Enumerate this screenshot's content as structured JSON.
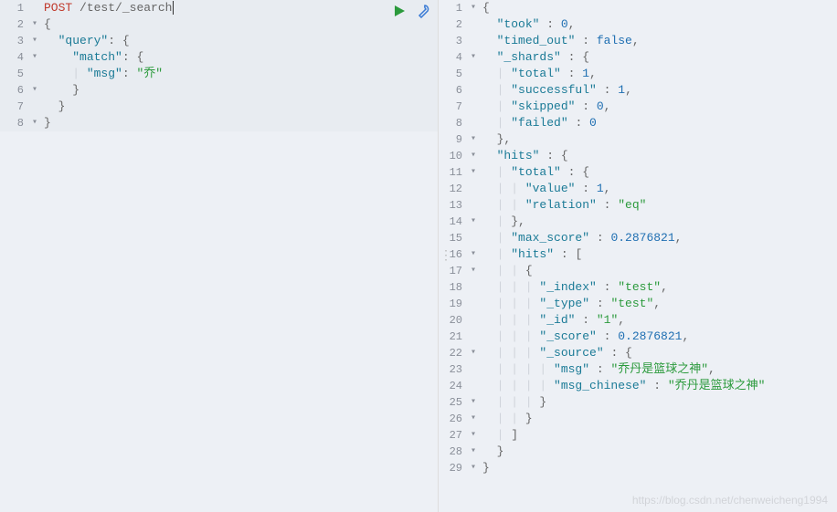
{
  "left": {
    "toolbar": {
      "run": "run-icon",
      "config": "wrench-icon"
    },
    "lines": [
      {
        "n": "1",
        "fold": "",
        "tokens": [
          [
            "method",
            "POST"
          ],
          [
            "plain",
            " "
          ],
          [
            "path",
            "/test/_search"
          ],
          [
            "cursor",
            ""
          ]
        ]
      },
      {
        "n": "2",
        "fold": "▾",
        "tokens": [
          [
            "brace",
            "{"
          ]
        ]
      },
      {
        "n": "3",
        "fold": "▾",
        "tokens": [
          [
            "plain",
            "  "
          ],
          [
            "key",
            "\"query\""
          ],
          [
            "colon",
            ": "
          ],
          [
            "brace",
            "{"
          ]
        ]
      },
      {
        "n": "4",
        "fold": "▾",
        "tokens": [
          [
            "plain",
            "    "
          ],
          [
            "key",
            "\"match\""
          ],
          [
            "colon",
            ": "
          ],
          [
            "brace",
            "{"
          ]
        ]
      },
      {
        "n": "5",
        "fold": "",
        "tokens": [
          [
            "indent",
            "    | "
          ],
          [
            "key",
            "\"msg\""
          ],
          [
            "colon",
            ": "
          ],
          [
            "string",
            "\"乔\""
          ]
        ]
      },
      {
        "n": "6",
        "fold": "▾",
        "tokens": [
          [
            "indent",
            "    "
          ],
          [
            "brace",
            "}"
          ]
        ]
      },
      {
        "n": "7",
        "fold": "",
        "tokens": [
          [
            "plain",
            "  "
          ],
          [
            "brace",
            "}"
          ]
        ]
      },
      {
        "n": "8",
        "fold": "▾",
        "tokens": [
          [
            "brace",
            "}"
          ]
        ]
      }
    ]
  },
  "right": {
    "lines": [
      {
        "n": "1",
        "fold": "▾",
        "tokens": [
          [
            "brace",
            "{"
          ]
        ]
      },
      {
        "n": "2",
        "fold": "",
        "tokens": [
          [
            "plain",
            "  "
          ],
          [
            "key",
            "\"took\""
          ],
          [
            "colon",
            " : "
          ],
          [
            "number",
            "0"
          ],
          [
            "punct",
            ","
          ]
        ]
      },
      {
        "n": "3",
        "fold": "",
        "tokens": [
          [
            "plain",
            "  "
          ],
          [
            "key",
            "\"timed_out\""
          ],
          [
            "colon",
            " : "
          ],
          [
            "bool",
            "false"
          ],
          [
            "punct",
            ","
          ]
        ]
      },
      {
        "n": "4",
        "fold": "▾",
        "tokens": [
          [
            "plain",
            "  "
          ],
          [
            "key",
            "\"_shards\""
          ],
          [
            "colon",
            " : "
          ],
          [
            "brace",
            "{"
          ]
        ]
      },
      {
        "n": "5",
        "fold": "",
        "tokens": [
          [
            "indent",
            "  | "
          ],
          [
            "key",
            "\"total\""
          ],
          [
            "colon",
            " : "
          ],
          [
            "number",
            "1"
          ],
          [
            "punct",
            ","
          ]
        ]
      },
      {
        "n": "6",
        "fold": "",
        "tokens": [
          [
            "indent",
            "  | "
          ],
          [
            "key",
            "\"successful\""
          ],
          [
            "colon",
            " : "
          ],
          [
            "number",
            "1"
          ],
          [
            "punct",
            ","
          ]
        ]
      },
      {
        "n": "7",
        "fold": "",
        "tokens": [
          [
            "indent",
            "  | "
          ],
          [
            "key",
            "\"skipped\""
          ],
          [
            "colon",
            " : "
          ],
          [
            "number",
            "0"
          ],
          [
            "punct",
            ","
          ]
        ]
      },
      {
        "n": "8",
        "fold": "",
        "tokens": [
          [
            "indent",
            "  | "
          ],
          [
            "key",
            "\"failed\""
          ],
          [
            "colon",
            " : "
          ],
          [
            "number",
            "0"
          ]
        ]
      },
      {
        "n": "9",
        "fold": "▾",
        "tokens": [
          [
            "plain",
            "  "
          ],
          [
            "brace",
            "}"
          ],
          [
            "punct",
            ","
          ]
        ]
      },
      {
        "n": "10",
        "fold": "▾",
        "tokens": [
          [
            "plain",
            "  "
          ],
          [
            "key",
            "\"hits\""
          ],
          [
            "colon",
            " : "
          ],
          [
            "brace",
            "{"
          ]
        ]
      },
      {
        "n": "11",
        "fold": "▾",
        "tokens": [
          [
            "indent",
            "  | "
          ],
          [
            "key",
            "\"total\""
          ],
          [
            "colon",
            " : "
          ],
          [
            "brace",
            "{"
          ]
        ]
      },
      {
        "n": "12",
        "fold": "",
        "tokens": [
          [
            "indent",
            "  | | "
          ],
          [
            "key",
            "\"value\""
          ],
          [
            "colon",
            " : "
          ],
          [
            "number",
            "1"
          ],
          [
            "punct",
            ","
          ]
        ]
      },
      {
        "n": "13",
        "fold": "",
        "tokens": [
          [
            "indent",
            "  | | "
          ],
          [
            "key",
            "\"relation\""
          ],
          [
            "colon",
            " : "
          ],
          [
            "string",
            "\"eq\""
          ]
        ]
      },
      {
        "n": "14",
        "fold": "▾",
        "tokens": [
          [
            "indent",
            "  | "
          ],
          [
            "brace",
            "}"
          ],
          [
            "punct",
            ","
          ]
        ]
      },
      {
        "n": "15",
        "fold": "",
        "tokens": [
          [
            "indent",
            "  | "
          ],
          [
            "key",
            "\"max_score\""
          ],
          [
            "colon",
            " : "
          ],
          [
            "number",
            "0.2876821"
          ],
          [
            "punct",
            ","
          ]
        ]
      },
      {
        "n": "16",
        "fold": "▾",
        "tokens": [
          [
            "indent",
            "  | "
          ],
          [
            "key",
            "\"hits\""
          ],
          [
            "colon",
            " : "
          ],
          [
            "brace",
            "["
          ]
        ]
      },
      {
        "n": "17",
        "fold": "▾",
        "tokens": [
          [
            "indent",
            "  | | "
          ],
          [
            "brace",
            "{"
          ]
        ]
      },
      {
        "n": "18",
        "fold": "",
        "tokens": [
          [
            "indent",
            "  | | | "
          ],
          [
            "key",
            "\"_index\""
          ],
          [
            "colon",
            " : "
          ],
          [
            "string",
            "\"test\""
          ],
          [
            "punct",
            ","
          ]
        ]
      },
      {
        "n": "19",
        "fold": "",
        "tokens": [
          [
            "indent",
            "  | | | "
          ],
          [
            "key",
            "\"_type\""
          ],
          [
            "colon",
            " : "
          ],
          [
            "string",
            "\"test\""
          ],
          [
            "punct",
            ","
          ]
        ]
      },
      {
        "n": "20",
        "fold": "",
        "tokens": [
          [
            "indent",
            "  | | | "
          ],
          [
            "key",
            "\"_id\""
          ],
          [
            "colon",
            " : "
          ],
          [
            "string",
            "\"1\""
          ],
          [
            "punct",
            ","
          ]
        ]
      },
      {
        "n": "21",
        "fold": "",
        "tokens": [
          [
            "indent",
            "  | | | "
          ],
          [
            "key",
            "\"_score\""
          ],
          [
            "colon",
            " : "
          ],
          [
            "number",
            "0.2876821"
          ],
          [
            "punct",
            ","
          ]
        ]
      },
      {
        "n": "22",
        "fold": "▾",
        "tokens": [
          [
            "indent",
            "  | | | "
          ],
          [
            "key",
            "\"_source\""
          ],
          [
            "colon",
            " : "
          ],
          [
            "brace",
            "{"
          ]
        ]
      },
      {
        "n": "23",
        "fold": "",
        "tokens": [
          [
            "indent",
            "  | | | | "
          ],
          [
            "key",
            "\"msg\""
          ],
          [
            "colon",
            " : "
          ],
          [
            "string",
            "\"乔丹是篮球之神\""
          ],
          [
            "punct",
            ","
          ]
        ]
      },
      {
        "n": "24",
        "fold": "",
        "tokens": [
          [
            "indent",
            "  | | | | "
          ],
          [
            "key",
            "\"msg_chinese\""
          ],
          [
            "colon",
            " : "
          ],
          [
            "string",
            "\"乔丹是篮球之神\""
          ]
        ]
      },
      {
        "n": "25",
        "fold": "▾",
        "tokens": [
          [
            "indent",
            "  | | | "
          ],
          [
            "brace",
            "}"
          ]
        ]
      },
      {
        "n": "26",
        "fold": "▾",
        "tokens": [
          [
            "indent",
            "  | | "
          ],
          [
            "brace",
            "}"
          ]
        ]
      },
      {
        "n": "27",
        "fold": "▾",
        "tokens": [
          [
            "indent",
            "  | "
          ],
          [
            "brace",
            "]"
          ]
        ]
      },
      {
        "n": "28",
        "fold": "▾",
        "tokens": [
          [
            "plain",
            "  "
          ],
          [
            "brace",
            "}"
          ]
        ]
      },
      {
        "n": "29",
        "fold": "▾",
        "tokens": [
          [
            "brace",
            "}"
          ]
        ]
      }
    ]
  },
  "watermark": "https://blog.csdn.net/chenweicheng1994"
}
